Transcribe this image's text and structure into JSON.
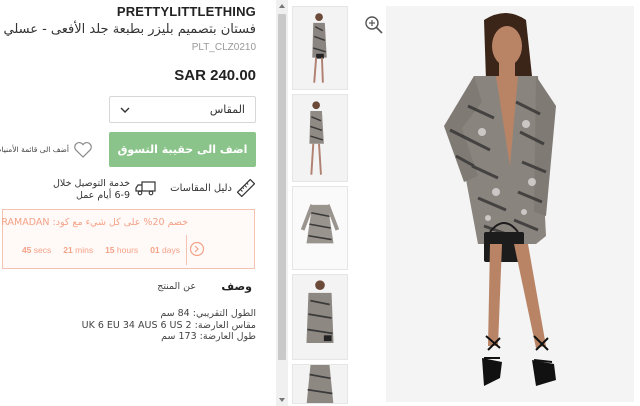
{
  "product": {
    "brand": "PRETTYLITTLETHING",
    "title": "فستان بتصميم بليزر بطبعة جلد الأفعى - عسلي",
    "sku": "PLT_CLZ0210",
    "price": "SAR 240.00"
  },
  "size_select": {
    "label": "المقاس"
  },
  "add_to_bag": {
    "label": "اضف الى حقيبة التسوق"
  },
  "wishlist": {
    "label": "أضف الى قائمة الأمنيات"
  },
  "delivery": {
    "line1": "خدمة التوصيل خلال",
    "line2": "6-9 أيام عمل"
  },
  "size_guide": {
    "label": "دليل المقاسات"
  },
  "promo": {
    "text": "خصم 20% على كل شيء مع كود: RAMADAN",
    "timer": {
      "days": "01",
      "days_label": "days",
      "hours": "15",
      "hours_label": "hours",
      "mins": "21",
      "mins_label": "mins",
      "secs": "45",
      "secs_label": "secs"
    }
  },
  "tabs": {
    "description": "وصف",
    "about": "عن المنتج"
  },
  "specs": {
    "line1": "الطول التقريبي: 84 سم",
    "line2": "مقاس العارضة: UK 6 EU 34 AUS 6 US 2",
    "line3": "طول العارضة: 173 سم"
  },
  "colors": {
    "accent_green": "#8bc48b",
    "promo_orange": "#f4a287",
    "promo_border": "#f3c2b0"
  },
  "icons": [
    "zoom-icon",
    "chevron-down-icon",
    "heart-icon",
    "delivery-truck-icon",
    "ruler-icon",
    "promo-tag-icon",
    "scroll-up-icon",
    "scroll-down-icon"
  ]
}
